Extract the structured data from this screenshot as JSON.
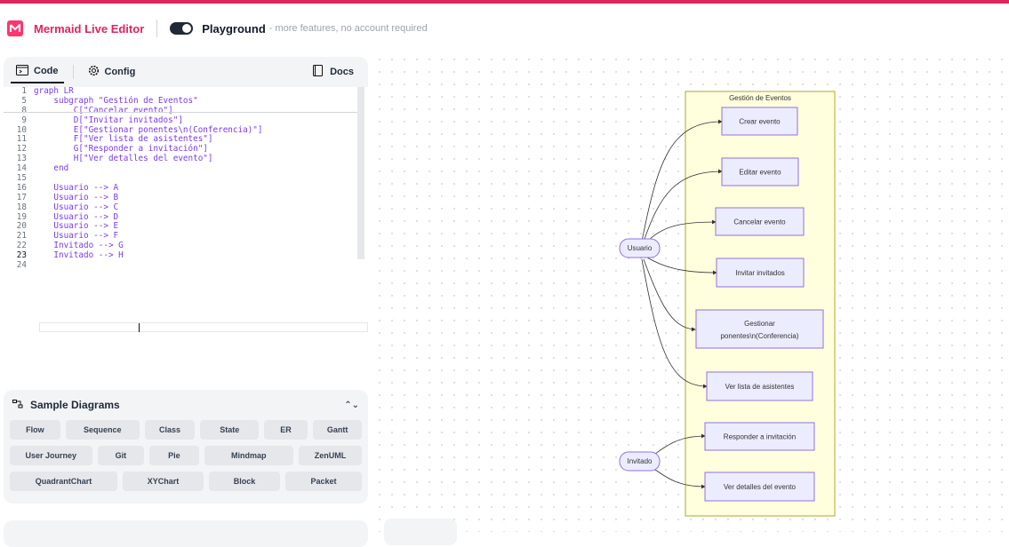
{
  "header": {
    "app_title": "Mermaid Live Editor",
    "playground_title": "Playground",
    "playground_subtitle": "- more features, no account required"
  },
  "editor": {
    "tabs": [
      {
        "label": "Code"
      },
      {
        "label": "Config"
      }
    ],
    "docs_label": "Docs",
    "lines": [
      {
        "n": "1",
        "text": "graph LR"
      },
      {
        "n": "5",
        "text": "    subgraph \"Gestión de Eventos\""
      },
      {
        "n": "8",
        "text": "        C[\"Cancelar evento\"]"
      },
      {
        "n": "9",
        "text": "        D[\"Invitar invitados\"]"
      },
      {
        "n": "10",
        "text": "        E[\"Gestionar ponentes\\n(Conferencia)\"]"
      },
      {
        "n": "11",
        "text": "        F[\"Ver lista de asistentes\"]"
      },
      {
        "n": "12",
        "text": "        G[\"Responder a invitación\"]"
      },
      {
        "n": "13",
        "text": "        H[\"Ver detalles del evento\"]"
      },
      {
        "n": "14",
        "text": "    end"
      },
      {
        "n": "15",
        "text": ""
      },
      {
        "n": "16",
        "text": "    Usuario --> A"
      },
      {
        "n": "17",
        "text": "    Usuario --> B"
      },
      {
        "n": "18",
        "text": "    Usuario --> C"
      },
      {
        "n": "19",
        "text": "    Usuario --> D"
      },
      {
        "n": "20",
        "text": "    Usuario --> E"
      },
      {
        "n": "21",
        "text": "    Usuario --> F"
      },
      {
        "n": "22",
        "text": "    Invitado --> G"
      },
      {
        "n": "23",
        "text": "    Invitado --> H"
      },
      {
        "n": "24",
        "text": ""
      }
    ]
  },
  "samples": {
    "title": "Sample Diagrams",
    "rows": [
      [
        "Flow",
        "Sequence",
        "Class",
        "State",
        "ER",
        "Gantt"
      ],
      [
        "User Journey",
        "Git",
        "Pie",
        "Mindmap",
        "ZenUML"
      ],
      [
        "QuadrantChart",
        "XYChart",
        "Block",
        "Packet"
      ]
    ]
  },
  "diagram": {
    "subgraph_title": "Gestión de Eventos",
    "actors": {
      "usuario": "Usuario",
      "invitado": "Invitado"
    },
    "nodes": {
      "a": "Crear evento",
      "b": "Editar evento",
      "c": "Cancelar evento",
      "d": "Invitar invitados",
      "e1": "Gestionar",
      "e2": "ponentes\\n(Conferencia)",
      "f": "Ver lista de asistentes",
      "g": "Responder a invitación",
      "h": "Ver detalles del evento"
    },
    "colors": {
      "node_fill": "#ECECFF",
      "node_stroke": "#9370DB",
      "cluster_fill": "#ffffde",
      "cluster_stroke": "#aaaa33"
    }
  }
}
